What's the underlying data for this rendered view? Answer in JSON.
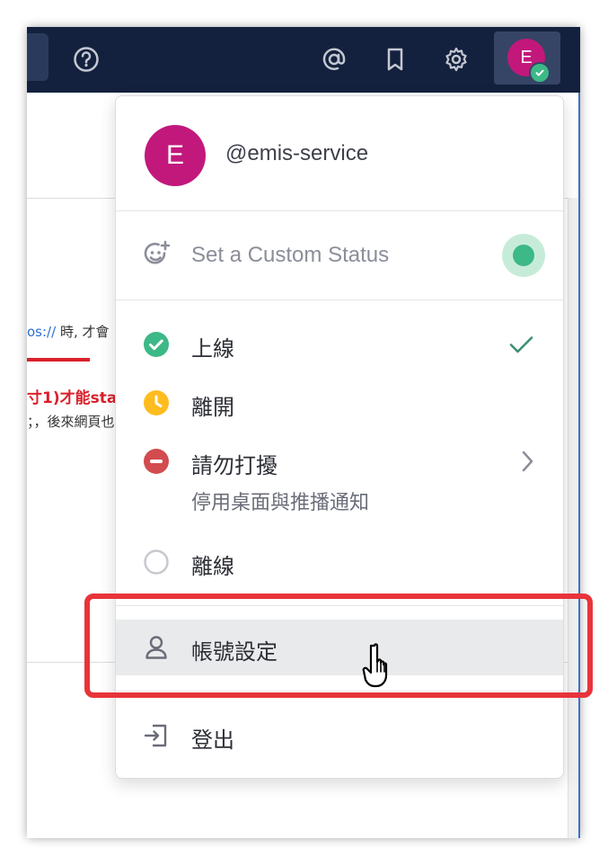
{
  "header": {
    "icons": [
      "help-icon",
      "mention-icon",
      "bookmark-icon",
      "gear-icon"
    ],
    "avatar_initial": "E"
  },
  "background": {
    "link_fragment": "os://",
    "text_fragment": "時, 才會",
    "red_fragment": "寸1)才能sta",
    "text_fragment_2": "；，後來網頁也"
  },
  "menu": {
    "avatar_initial": "E",
    "username": "@emis-service",
    "custom_status_placeholder": "Set a Custom Status",
    "statuses": [
      {
        "label": "上線",
        "color": "#3db887",
        "icon": "online-icon",
        "selected": true
      },
      {
        "label": "離開",
        "color": "#ffbc1f",
        "icon": "away-icon"
      },
      {
        "label": "請勿打擾",
        "sub": "停用桌面與推播通知",
        "color": "#d24b4e",
        "icon": "dnd-icon"
      },
      {
        "label": "離線",
        "color": "#c7c9cf",
        "icon": "offline-icon"
      }
    ],
    "account_settings": "帳號設定",
    "logout": "登出"
  }
}
